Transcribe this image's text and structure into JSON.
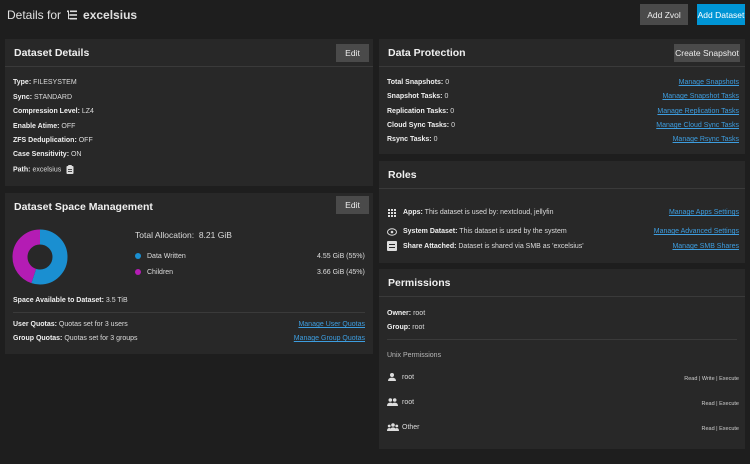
{
  "header": {
    "title_prefix": "Details for",
    "dataset_name": "excelsius",
    "add_zvol_label": "Add Zvol",
    "add_dataset_label": "Add Dataset"
  },
  "dataset_details": {
    "title": "Dataset Details",
    "edit_label": "Edit",
    "rows": [
      {
        "label": "Type:",
        "value": "FILESYSTEM"
      },
      {
        "label": "Sync:",
        "value": "STANDARD"
      },
      {
        "label": "Compression Level:",
        "value": "LZ4"
      },
      {
        "label": "Enable Atime:",
        "value": "OFF"
      },
      {
        "label": "ZFS Deduplication:",
        "value": "OFF"
      },
      {
        "label": "Case Sensitivity:",
        "value": "ON"
      },
      {
        "label": "Path:",
        "value": "excelsius"
      }
    ]
  },
  "space_management": {
    "title": "Dataset Space Management",
    "edit_label": "Edit",
    "total_allocation_label": "Total Allocation:",
    "total_allocation_value": "8.21 GiB",
    "legend": [
      {
        "label": "Data Written",
        "value": "4.55 GiB (55%)",
        "color": "#1a8fd1",
        "percent": 55
      },
      {
        "label": "Children",
        "value": "3.66 GiB (45%)",
        "color": "#b41cb4",
        "percent": 45
      }
    ],
    "space_available_label": "Space Available to Dataset:",
    "space_available_value": "3.5 TiB",
    "user_quotas_label": "User Quotas:",
    "user_quotas_value": "Quotas set for 3 users",
    "manage_user_quotas": "Manage User Quotas",
    "group_quotas_label": "Group Quotas:",
    "group_quotas_value": "Quotas set for 3 groups",
    "manage_group_quotas": "Manage Group Quotas"
  },
  "data_protection": {
    "title": "Data Protection",
    "create_snapshot_label": "Create Snapshot",
    "rows": [
      {
        "label": "Total Snapshots:",
        "value": "0",
        "link": "Manage Snapshots"
      },
      {
        "label": "Snapshot Tasks:",
        "value": "0",
        "link": "Manage Snapshot Tasks"
      },
      {
        "label": "Replication Tasks:",
        "value": "0",
        "link": "Manage Replication Tasks"
      },
      {
        "label": "Cloud Sync Tasks:",
        "value": "0",
        "link": "Manage Cloud Sync Tasks"
      },
      {
        "label": "Rsync Tasks:",
        "value": "0",
        "link": "Manage Rsync Tasks"
      }
    ]
  },
  "roles": {
    "title": "Roles",
    "rows": [
      {
        "label": "Apps:",
        "value": "This dataset is used by: nextcloud, jellyfin",
        "link": "Manage Apps Settings",
        "icon": "apps-grid-icon"
      },
      {
        "label": "System Dataset:",
        "value": "This dataset is used by the system",
        "link": "Manage Advanced Settings",
        "icon": "system-gear-icon"
      },
      {
        "label": "Share Attached:",
        "value": "Dataset is shared via SMB as 'excelsius'",
        "link": "Manage SMB Shares",
        "icon": "smb-share-icon"
      }
    ]
  },
  "permissions": {
    "title": "Permissions",
    "owner_label": "Owner:",
    "owner_value": "root",
    "group_label": "Group:",
    "group_value": "root",
    "unix_label": "Unix Permissions",
    "entries": [
      {
        "name": "root",
        "perms": "Read | Write | Execute",
        "icon": "user-icon"
      },
      {
        "name": "root",
        "perms": "Read | Execute",
        "icon": "group-icon"
      },
      {
        "name": "Other",
        "perms": "Read | Execute",
        "icon": "others-icon"
      }
    ]
  }
}
